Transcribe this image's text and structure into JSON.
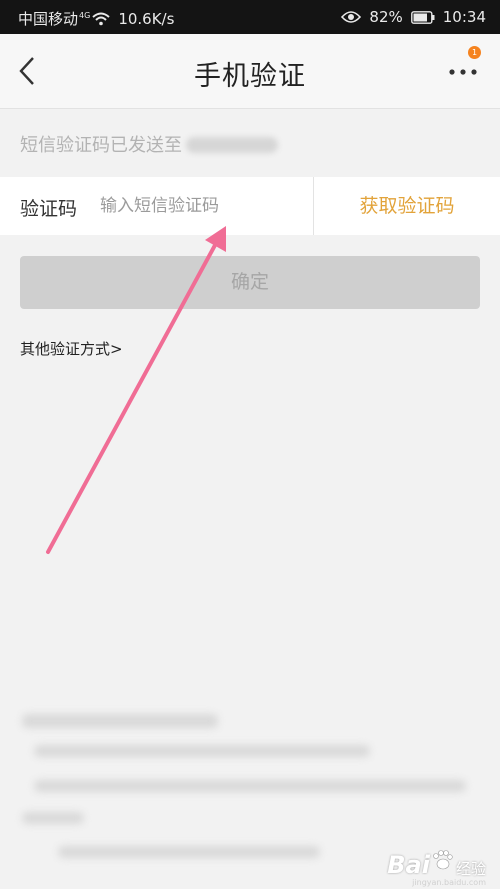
{
  "status_bar": {
    "carrier": "中国移动",
    "network": "4G",
    "speed": "10.6K/s",
    "battery": "82%",
    "time": "10:34",
    "background": "#141414"
  },
  "header": {
    "title": "手机验证",
    "back_icon": "chevron-left-icon",
    "more_icon": "more-dots-icon",
    "badge_count": "1",
    "badge_color": "#f5831f"
  },
  "notice": {
    "text": "短信验证码已发送至"
  },
  "verification": {
    "label": "验证码",
    "placeholder": "输入短信验证码",
    "get_code_label": "获取验证码",
    "accent_color": "#e2a33a"
  },
  "confirm": {
    "label": "确定",
    "enabled": false
  },
  "other_methods": {
    "label": "其他验证方式>"
  },
  "annotation": {
    "type": "arrow",
    "color": "#f06d95"
  },
  "watermark": {
    "logo": "Bai",
    "logo_suffix": "经验",
    "sub": "jingyan.baidu.com"
  }
}
